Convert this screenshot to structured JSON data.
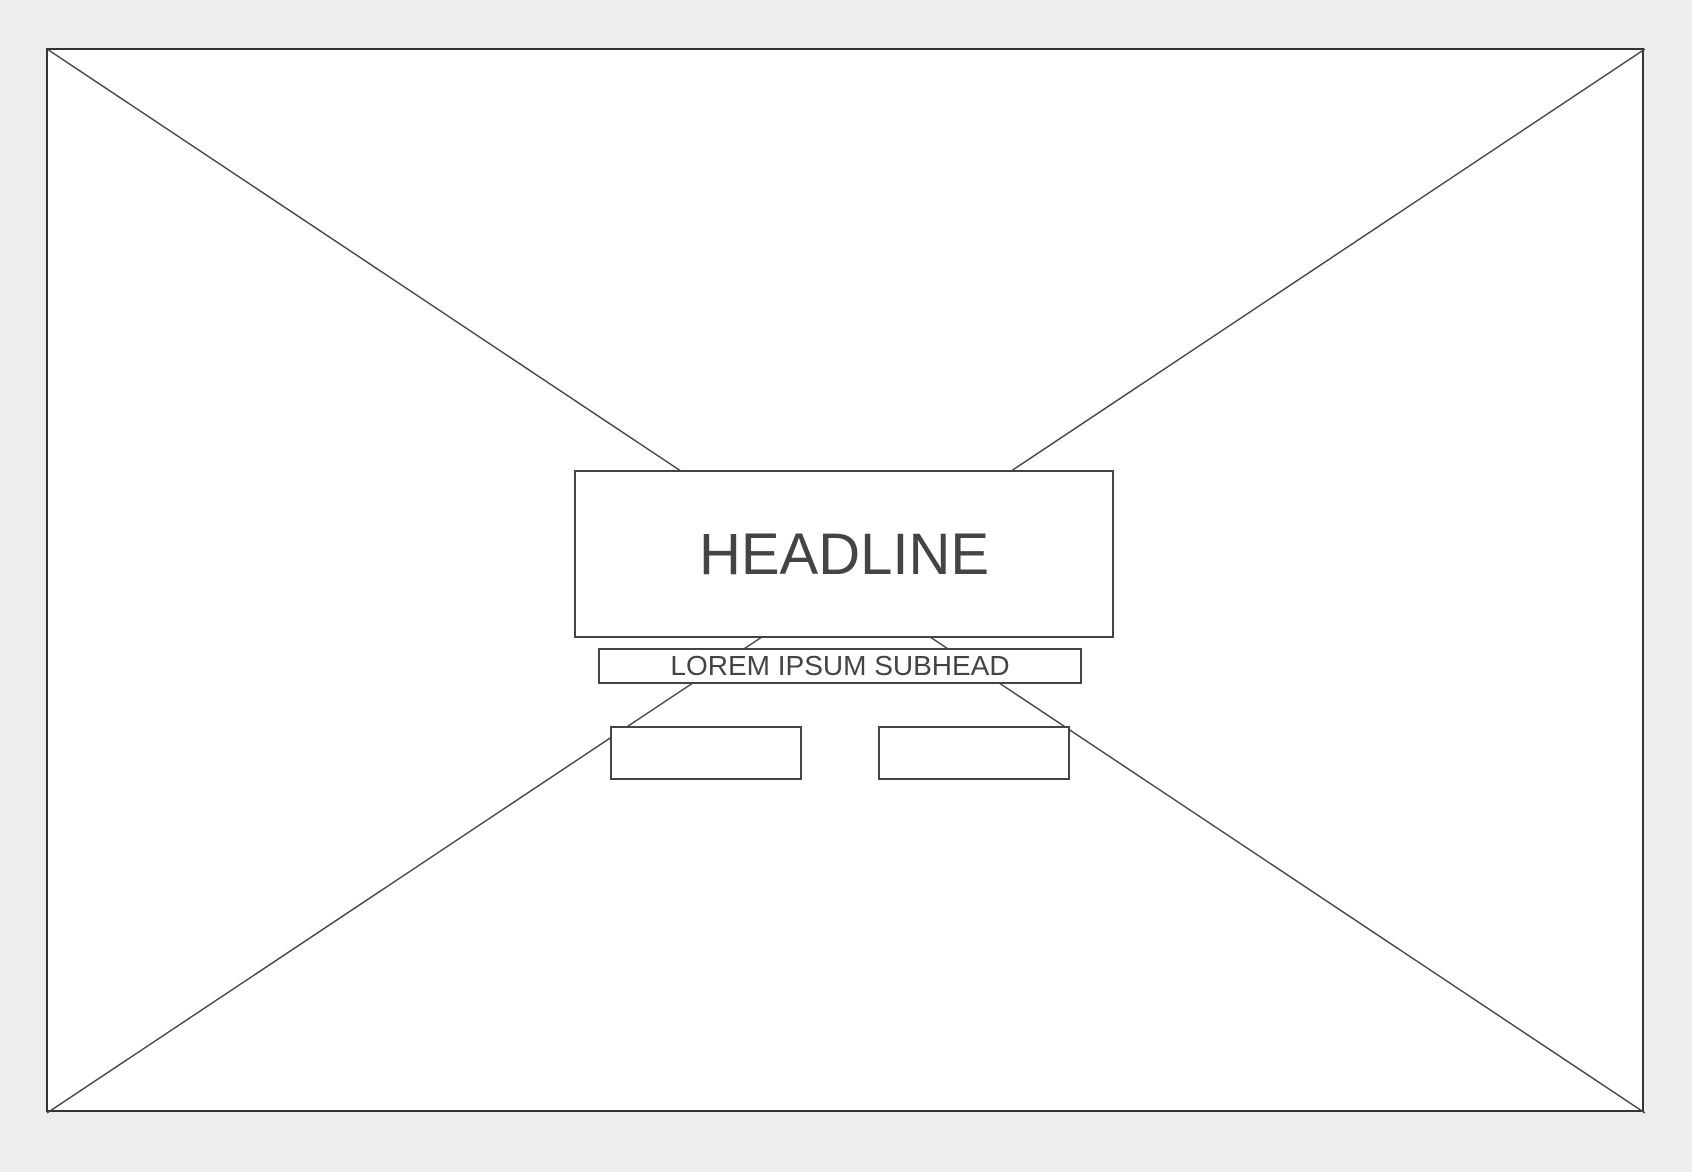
{
  "wireframe": {
    "headline": "HEADLINE",
    "subhead": "LOREM IPSUM SUBHEAD",
    "primary_button_label": "",
    "secondary_button_label": ""
  },
  "colors": {
    "background": "#ededed",
    "frame": "#ffffff",
    "stroke": "#444444"
  },
  "icons": {
    "placeholder": "image-placeholder-x-icon"
  }
}
